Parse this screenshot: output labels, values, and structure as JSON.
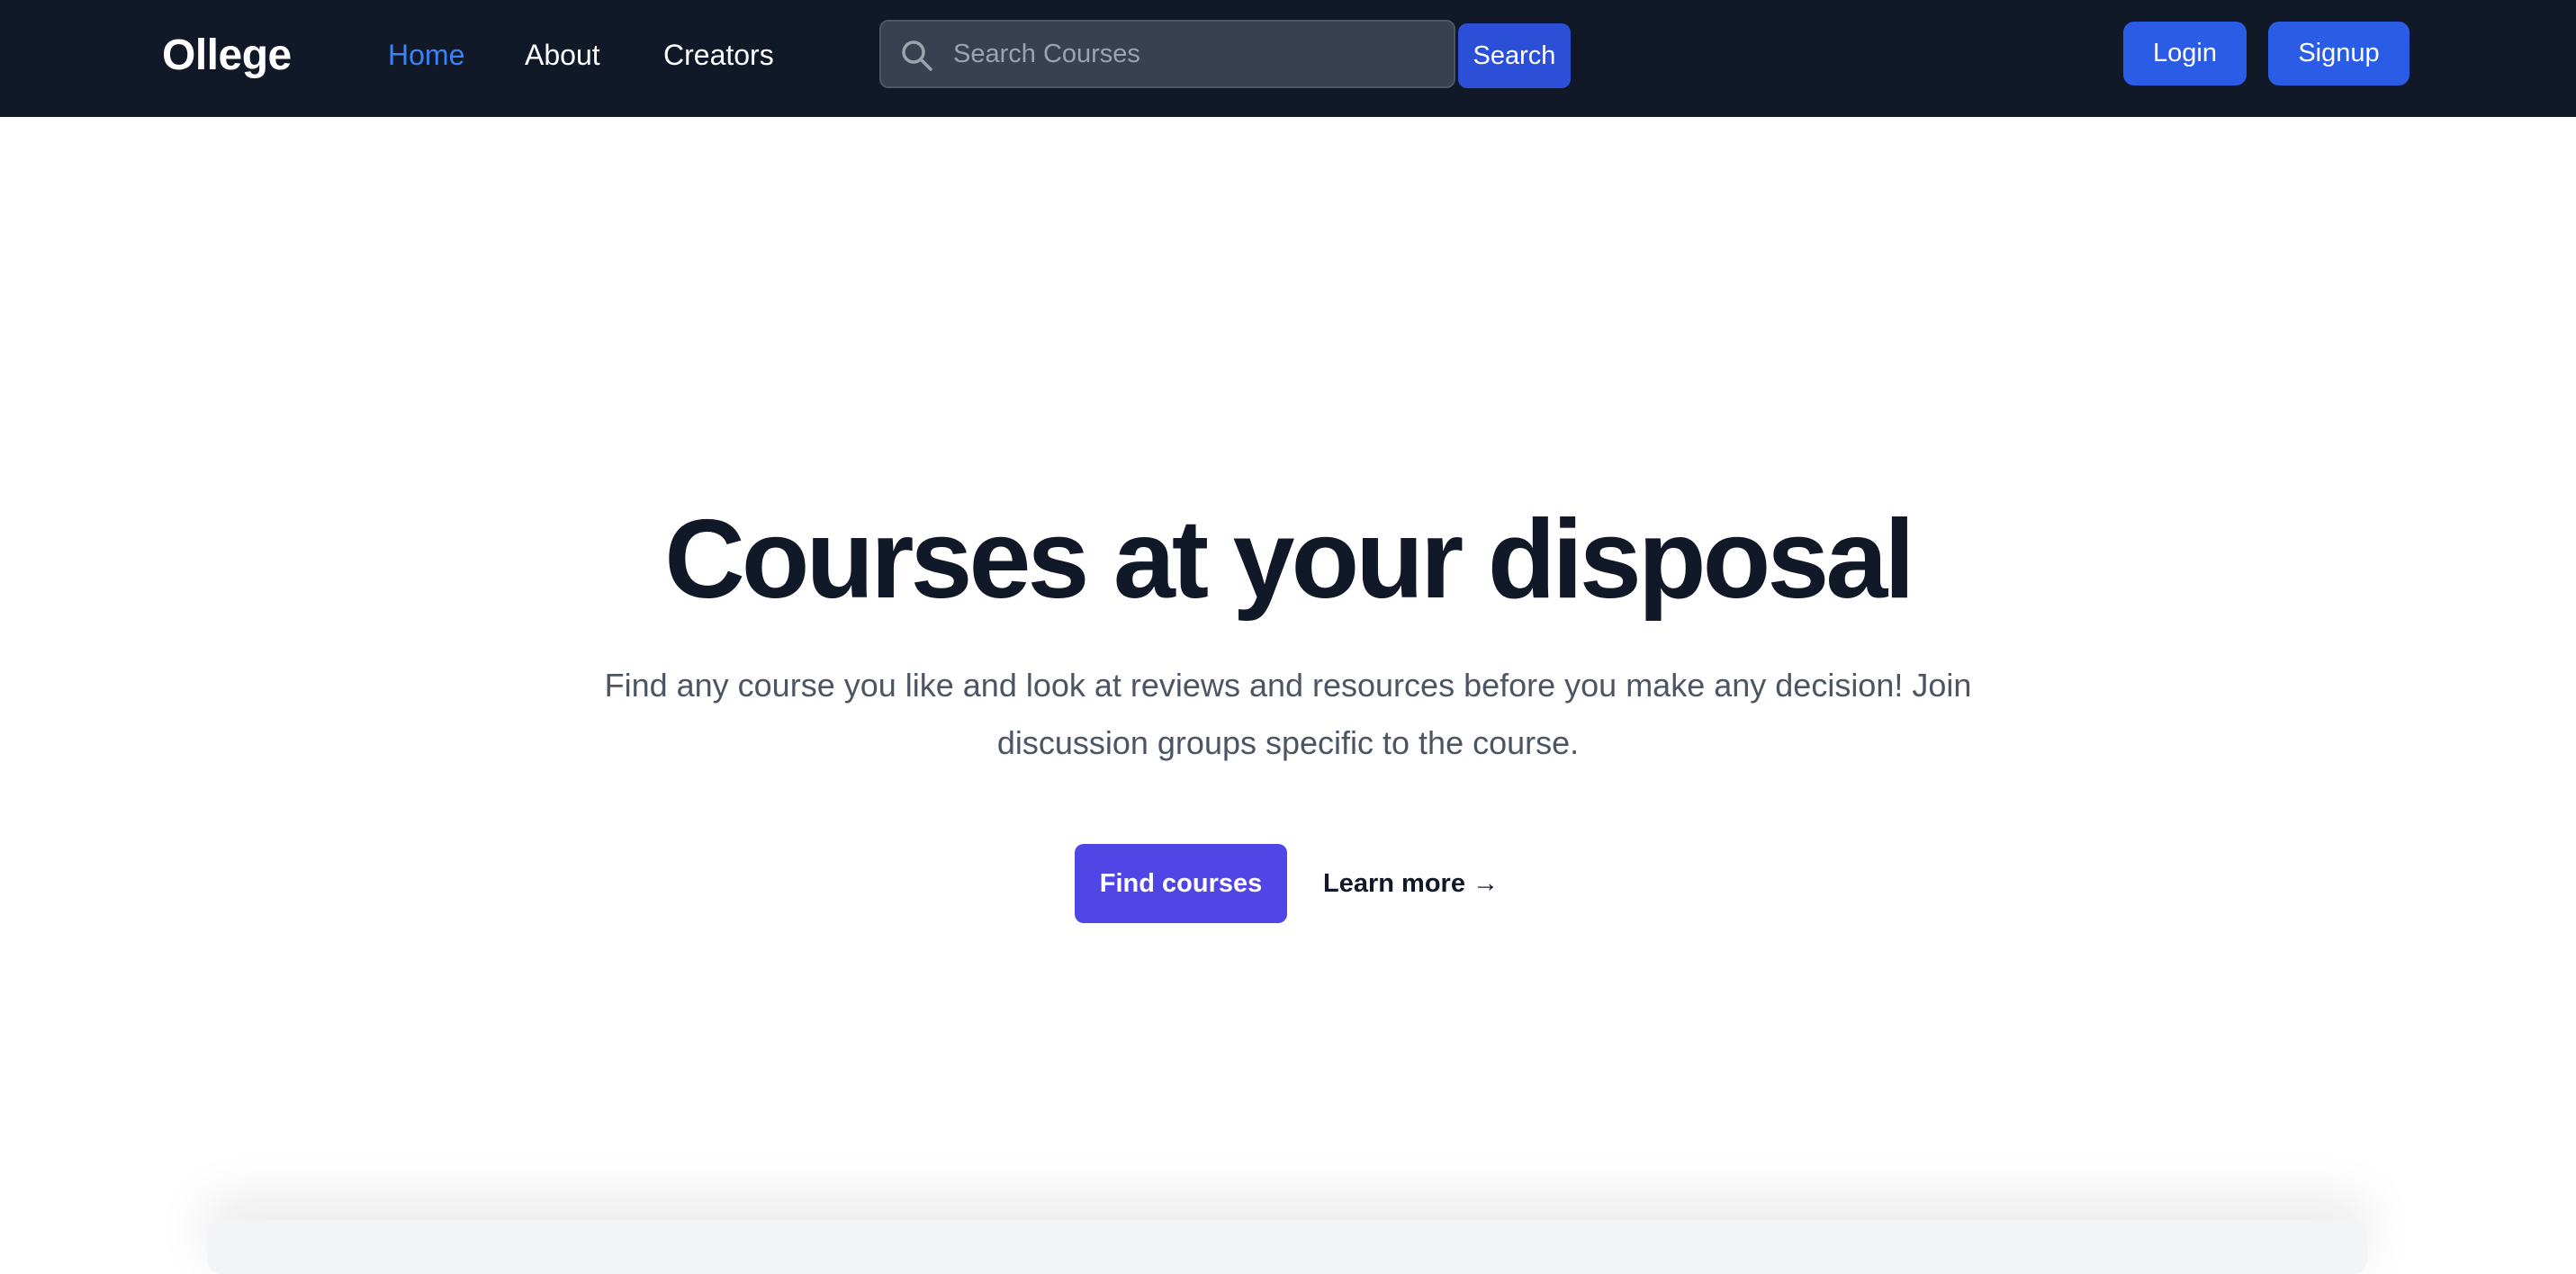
{
  "header": {
    "brand": "Ollege",
    "nav": [
      {
        "label": "Home",
        "active": true
      },
      {
        "label": "About",
        "active": false
      },
      {
        "label": "Creators",
        "active": false
      }
    ],
    "search": {
      "placeholder": "Search Courses",
      "value": "",
      "button_label": "Search",
      "icon": "search-icon"
    },
    "login_label": "Login",
    "signup_label": "Signup"
  },
  "hero": {
    "title": "Courses at your disposal",
    "description": "Find any course you like and look at reviews and resources before you make any decision! Join discussion groups specific to the course.",
    "primary_cta": "Find courses",
    "secondary_cta": "Learn more →"
  },
  "colors": {
    "navbar_bg": "#111827",
    "active_link": "#3b82f6",
    "button_blue": "#2b5ce6",
    "primary_cta": "#4f46e5",
    "title_text": "#111827",
    "body_text": "#4b5563"
  }
}
